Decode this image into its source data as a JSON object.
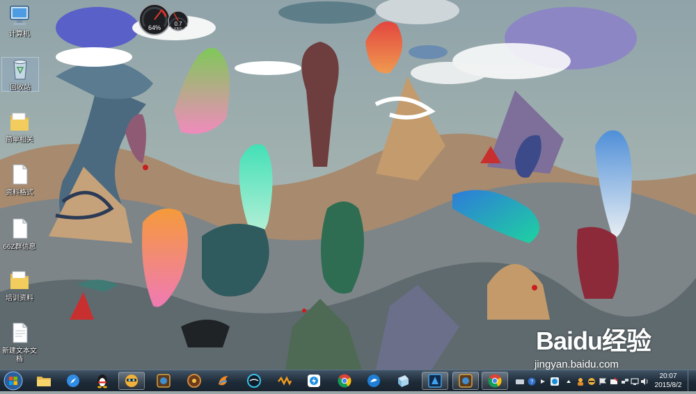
{
  "desktop": {
    "icons": [
      {
        "label": "计算机",
        "icon": "computer-icon"
      },
      {
        "label": "回收站",
        "icon": "recycle-bin-icon"
      },
      {
        "label": "简单相关",
        "icon": "folder-icon"
      },
      {
        "label": "资料格式",
        "icon": "document-icon"
      },
      {
        "label": "66Z群信息",
        "icon": "document-icon"
      },
      {
        "label": "培训资料",
        "icon": "folder-icon"
      },
      {
        "label": "新建文本文档",
        "icon": "text-document-icon"
      }
    ]
  },
  "gadget": {
    "cpu_percent": "64%",
    "net_value": "0.7",
    "net_unit": "KB/S",
    "cpu_level": 0.64
  },
  "taskbar": {
    "apps": [
      {
        "name": "explorer",
        "icon": "folder-icon",
        "active": false
      },
      {
        "name": "browser-compass",
        "icon": "compass-icon",
        "active": false
      },
      {
        "name": "qq",
        "icon": "penguin-icon",
        "active": false
      },
      {
        "name": "qq-game",
        "icon": "game-character-icon",
        "active": true
      },
      {
        "name": "hearthstone-launcher",
        "icon": "game-emblem-icon",
        "active": false
      },
      {
        "name": "wheel-app",
        "icon": "wheel-icon",
        "active": false
      },
      {
        "name": "flame-app",
        "icon": "flame-icon",
        "active": false
      },
      {
        "name": "ring-app",
        "icon": "ring-icon",
        "active": false
      },
      {
        "name": "wave-app",
        "icon": "wave-icon",
        "active": false
      },
      {
        "name": "qq-lightning",
        "icon": "bolt-icon",
        "active": false
      },
      {
        "name": "chrome",
        "icon": "chrome-icon",
        "active": false
      },
      {
        "name": "speed-app",
        "icon": "speed-icon",
        "active": false
      },
      {
        "name": "cube-app",
        "icon": "cube-icon",
        "active": false
      },
      {
        "name": "game-client-1",
        "icon": "game-emblem-icon",
        "active": true
      },
      {
        "name": "game-client-2",
        "icon": "game-emblem-icon",
        "active": true
      },
      {
        "name": "chrome-window",
        "icon": "chrome-icon",
        "active": true
      }
    ]
  },
  "tray": {
    "icons": [
      "keyboard-icon",
      "help-icon",
      "arrow-icon",
      "shield-icon",
      "chevron-up-icon",
      "person-icon",
      "game-icon",
      "flag-icon",
      "mail-icon",
      "network-icon",
      "monitor-icon",
      "volume-icon"
    ],
    "time": "20:07",
    "date": "2015/8/2"
  },
  "watermark": {
    "brand": "Baidu经验",
    "url": "jingyan.baidu.com"
  },
  "colors": {
    "taskbar": "#1e2b38",
    "accent": "#3a8ee6"
  }
}
